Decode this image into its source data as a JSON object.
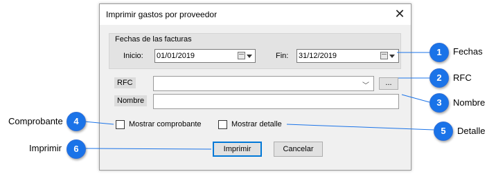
{
  "dialog": {
    "title": "Imprimir gastos por proveedor",
    "close_icon": "close-icon",
    "group_title": "Fechas de las facturas",
    "inicio_label": "Inicio:",
    "inicio_value": "01/01/2019",
    "fin_label": "Fin:",
    "fin_value": "31/12/2019",
    "rfc_label": "RFC",
    "rfc_value": "",
    "ellipsis_label": "...",
    "nombre_label": "Nombre",
    "nombre_value": "",
    "mostrar_comprobante": "Mostrar comprobante",
    "mostrar_detalle": "Mostrar detalle",
    "imprimir_button": "Imprimir",
    "cancelar_button": "Cancelar"
  },
  "callouts": [
    {
      "number": "1",
      "label": "Fechas"
    },
    {
      "number": "2",
      "label": "RFC"
    },
    {
      "number": "3",
      "label": "Nombre"
    },
    {
      "number": "4",
      "label": "Comprobante"
    },
    {
      "number": "5",
      "label": "Detalle"
    },
    {
      "number": "6",
      "label": "Imprimir"
    }
  ],
  "colors": {
    "accent": "#1a73e8",
    "dialog_bg": "#f0f0f0",
    "focus_border": "#0078d7"
  }
}
